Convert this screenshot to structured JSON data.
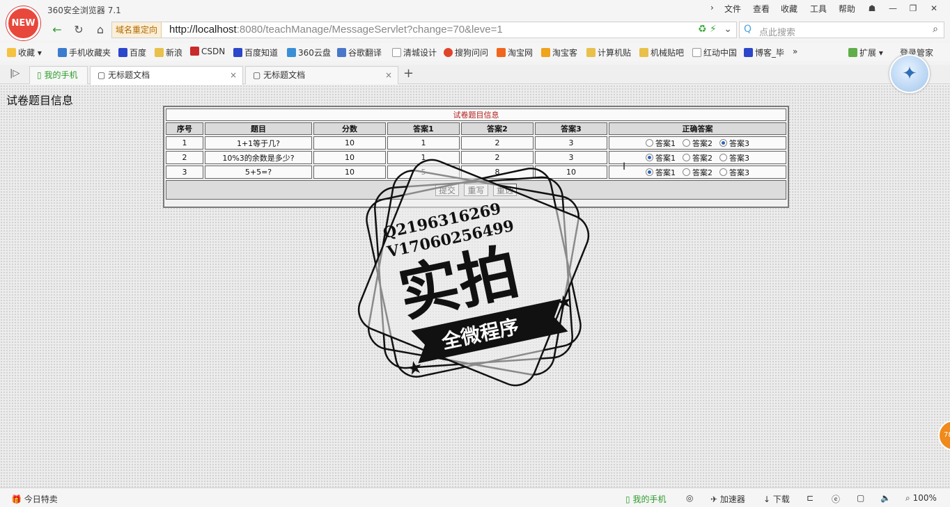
{
  "browser": {
    "logo_text": "NEW",
    "app_title": "360安全浏览器 7.1",
    "menu": [
      "文件",
      "查看",
      "收藏",
      "工具",
      "帮助"
    ],
    "redirect_badge": "域名重定向",
    "url_host": "http://localhost",
    "url_path": ":8080/teachManage/MessageServlet?change=70&leve=1",
    "search_placeholder": "点此搜索"
  },
  "bookmarks": [
    "收藏",
    "手机收藏夹",
    "百度",
    "新浪",
    "CSDN",
    "百度知道",
    "360云盘",
    "谷歌翻译",
    "清城设计",
    "搜狗问问",
    "淘宝网",
    "淘宝客",
    "计算机贴",
    "机械贴吧",
    "红动中国",
    "博客_毕"
  ],
  "bookmark_right": [
    "扩展",
    "登录管家"
  ],
  "tabs": {
    "mobile": "我的手机",
    "items": [
      {
        "label": "无标题文档",
        "active": true
      },
      {
        "label": "无标题文档",
        "active": false
      }
    ]
  },
  "page": {
    "heading": "试卷题目信息",
    "table_caption": "试卷题目信息",
    "columns": [
      "序号",
      "题目",
      "分数",
      "答案1",
      "答案2",
      "答案3",
      "正确答案"
    ],
    "rows": [
      {
        "no": "1",
        "question": "1+1等于几?",
        "score": "10",
        "a1": "1",
        "a2": "2",
        "a3": "3",
        "correct": 3
      },
      {
        "no": "2",
        "question": "10%3的余数是多少?",
        "score": "10",
        "a1": "1",
        "a2": "2",
        "a3": "3",
        "correct": 1
      },
      {
        "no": "3",
        "question": "5+5=?",
        "score": "10",
        "a1": "5",
        "a2": "8",
        "a3": "10",
        "correct": 1
      }
    ],
    "answer_labels": [
      "答案1",
      "答案2",
      "答案3"
    ],
    "buttons": [
      "提交",
      "重写",
      "重选"
    ]
  },
  "watermark": {
    "line1": "Q2196316269",
    "line2": "V17060256499",
    "main": "实拍",
    "ribbon": "全微程序"
  },
  "statusbar": {
    "left": "今日特卖",
    "mobile": "我的手机",
    "accelerator": "加速器",
    "download": "下载",
    "zoom": "100%"
  },
  "colors": {
    "caption": "#b01a1a",
    "radio_selected": "#2b63b8",
    "logo": "#e8473b"
  }
}
